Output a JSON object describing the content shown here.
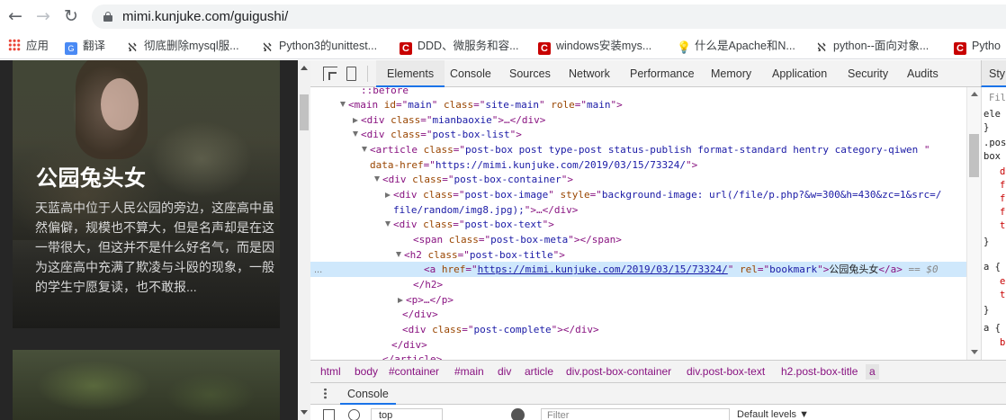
{
  "browser": {
    "url": "mimi.kunjuke.com/guigushi/"
  },
  "bookmarks": [
    {
      "label": "应用",
      "icon": "apps-grid-icon"
    },
    {
      "label": "翻译",
      "icon": "translate-icon"
    },
    {
      "label": "彻底删除mysql服...",
      "icon": "k-logo-icon"
    },
    {
      "label": "Python3的unittest...",
      "icon": "k-logo-icon"
    },
    {
      "label": "DDD、微服务和容...",
      "icon": "c-logo-icon"
    },
    {
      "label": "windows安装mys...",
      "icon": "c-logo-icon"
    },
    {
      "label": "什么是Apache和N...",
      "icon": "bulb-icon"
    },
    {
      "label": "python--面向对象...",
      "icon": "k-logo-icon"
    },
    {
      "label": "Pytho",
      "icon": "c-logo-icon"
    }
  ],
  "page": {
    "card_title": "公园兔头女",
    "card_text": "天蓝高中位于人民公园的旁边，这座高中虽然偏僻，规模也不算大，但是名声却是在这一带很大，但这并不是什么好名气，而是因为这座高中充满了欺凌与斗殴的现象，一般的学生宁愿复读，也不敢报..."
  },
  "devtools": {
    "tabs": [
      "Elements",
      "Console",
      "Sources",
      "Network",
      "Performance",
      "Memory",
      "Application",
      "Security",
      "Audits"
    ],
    "active_tab": "Elements",
    "styles_tab": "Sty",
    "styles_lines": [
      "Filt",
      "ele",
      "}",
      ".pos",
      "box",
      "d",
      "f",
      "f",
      "f",
      "t",
      "}",
      "a {",
      "e",
      "t",
      "}",
      "a {",
      "b"
    ],
    "code_lines": [
      {
        "html": "<span class=\"tag\">::before</span>"
      },
      {
        "html": "<span class=\"tag\">&lt;main </span><span class=\"an\">id</span><span class=\"tag\">=\"</span><span class=\"av\">main</span><span class=\"tag\">\" </span><span class=\"an\">class</span><span class=\"tag\">=\"</span><span class=\"av\">site-main</span><span class=\"tag\">\" </span><span class=\"an\">role</span><span class=\"tag\">=\"</span><span class=\"av\">main</span><span class=\"tag\">\"&gt;</span>"
      },
      {
        "html": "<span class=\"tag\">&lt;div </span><span class=\"an\">class</span><span class=\"tag\">=\"</span><span class=\"av\">mianbaoxie</span><span class=\"tag\">\"&gt;</span>…<span class=\"tag\">&lt;/div&gt;</span>"
      },
      {
        "html": "<span class=\"tag\">&lt;div </span><span class=\"an\">class</span><span class=\"tag\">=\"</span><span class=\"av\">post-box-list</span><span class=\"tag\">\"&gt;</span>"
      },
      {
        "html": "<span class=\"tag\">&lt;article </span><span class=\"an\">class</span><span class=\"tag\">=\"</span><span class=\"av\">post-box post type-post status-publish format-standard hentry category-qiwen </span><span class=\"tag\">\"</span>"
      },
      {
        "html": "<span class=\"an\">data-href</span><span class=\"tag\">=\"</span><span class=\"av\">https://mimi.kunjuke.com/2019/03/15/73324/</span><span class=\"tag\">\"&gt;</span>"
      },
      {
        "html": "<span class=\"tag\">&lt;div </span><span class=\"an\">class</span><span class=\"tag\">=\"</span><span class=\"av\">post-box-container</span><span class=\"tag\">\"&gt;</span>"
      },
      {
        "html": "<span class=\"tag\">&lt;div </span><span class=\"an\">class</span><span class=\"tag\">=\"</span><span class=\"av\">post-box-image</span><span class=\"tag\">\" </span><span class=\"an\">style</span><span class=\"tag\">=\"</span><span class=\"av\">background-image: url(/file/p.php?&amp;w=300&amp;h=430&amp;zc=1&amp;src=/</span>"
      },
      {
        "html": "<span class=\"av\">file/random/img8.jpg);</span><span class=\"tag\">\"&gt;</span>…<span class=\"tag\">&lt;/div&gt;</span>"
      },
      {
        "html": "<span class=\"tag\">&lt;div </span><span class=\"an\">class</span><span class=\"tag\">=\"</span><span class=\"av\">post-box-text</span><span class=\"tag\">\"&gt;</span>"
      },
      {
        "html": "<span class=\"tag\">&lt;span </span><span class=\"an\">class</span><span class=\"tag\">=\"</span><span class=\"av\">post-box-meta</span><span class=\"tag\">\"&gt;&lt;/span&gt;</span>"
      },
      {
        "html": "<span class=\"tag\">&lt;h2 </span><span class=\"an\">class</span><span class=\"tag\">=\"</span><span class=\"av\">post-box-title</span><span class=\"tag\">\"&gt;</span>"
      },
      {
        "html": "<span class=\"tag\">&lt;a </span><span class=\"an\">href</span><span class=\"tag\">=\"</span><span class=\"lnk\">https://mimi.kunjuke.com/2019/03/15/73324/</span><span class=\"tag\">\" </span><span class=\"an\">rel</span><span class=\"tag\">=\"</span><span class=\"av\">bookmark</span><span class=\"tag\">\"&gt;</span><span class=\"tx\">公园兔头女</span><span class=\"tag\">&lt;/a&gt;</span><span class=\"eq\"> == </span><span class=\"dl\">$0</span>"
      },
      {
        "html": "<span class=\"tag\">&lt;/h2&gt;</span>"
      },
      {
        "html": "<span class=\"tag\">&lt;p&gt;</span>…<span class=\"tag\">&lt;/p&gt;</span>"
      },
      {
        "html": "<span class=\"tag\">&lt;/div&gt;</span>"
      },
      {
        "html": "<span class=\"tag\">&lt;div </span><span class=\"an\">class</span><span class=\"tag\">=\"</span><span class=\"av\">post-complete</span><span class=\"tag\">\"&gt;&lt;/div&gt;</span>"
      },
      {
        "html": "<span class=\"tag\">&lt;/div&gt;</span>"
      },
      {
        "html": "<span class=\"tag\">&lt;/article&gt;</span>"
      }
    ],
    "breadcrumbs": [
      "html",
      "body",
      "#container",
      "#main",
      "div",
      "article",
      "div.post-box-container",
      "div.post-box-text",
      "h2.post-box-title",
      "a"
    ],
    "drawer_tab": "Console",
    "context": "top",
    "filter_placeholder": "Filter",
    "levels": "Default levels ▼",
    "selected_marker": "..."
  }
}
